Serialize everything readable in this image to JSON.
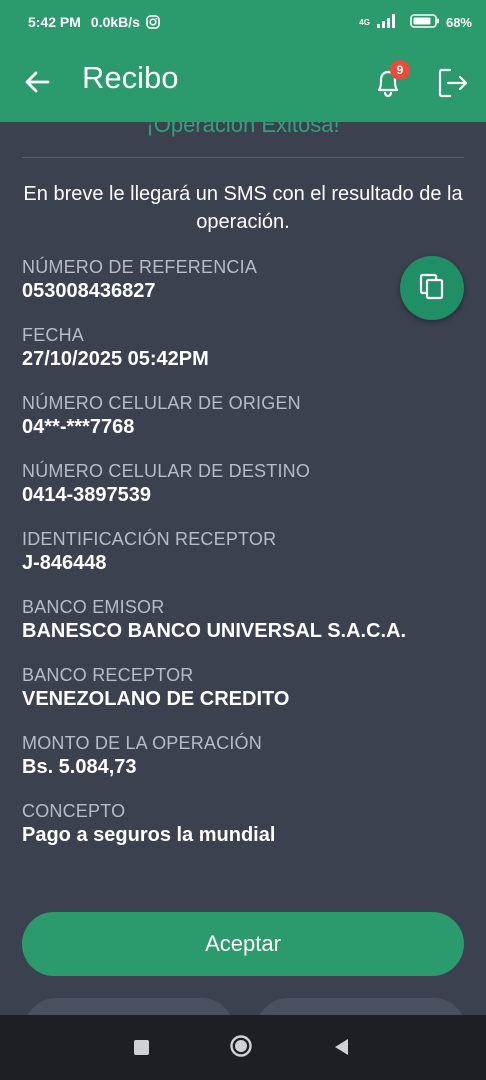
{
  "status_bar": {
    "time": "5:42 PM",
    "speed": "0.0kB/s",
    "network": "4G",
    "battery": "68%"
  },
  "app_bar": {
    "title": "Recibo",
    "notification_count": "9",
    "icons": [
      "back-arrow-icon",
      "bell-icon",
      "logout-icon"
    ]
  },
  "receipt": {
    "success_title": "¡Operación Exitosa!",
    "sms_message": "En breve le llegará un SMS con el resultado de la operación.",
    "fields": [
      {
        "label": "NÚMERO DE REFERENCIA",
        "value": "053008436827"
      },
      {
        "label": "FECHA",
        "value": "27/10/2025 05:42PM"
      },
      {
        "label": "NÚMERO CELULAR DE ORIGEN",
        "value": "04**-***7768"
      },
      {
        "label": "NÚMERO CELULAR DE DESTINO",
        "value": "0414-3897539"
      },
      {
        "label": "IDENTIFICACIÓN RECEPTOR",
        "value": "J-846448"
      },
      {
        "label": "BANCO EMISOR",
        "value": "BANESCO BANCO UNIVERSAL S.A.C.A."
      },
      {
        "label": "BANCO RECEPTOR",
        "value": "VENEZOLANO DE CREDITO"
      },
      {
        "label": "MONTO DE LA OPERACIÓN",
        "value": "Bs. 5.084,73"
      },
      {
        "label": "CONCEPTO",
        "value": "Pago a seguros la mundial"
      }
    ]
  },
  "actions": {
    "accept_label": "Aceptar"
  },
  "colors": {
    "primary": "#2b9a6d",
    "background": "#3c4150",
    "badge": "#e94b3c"
  }
}
